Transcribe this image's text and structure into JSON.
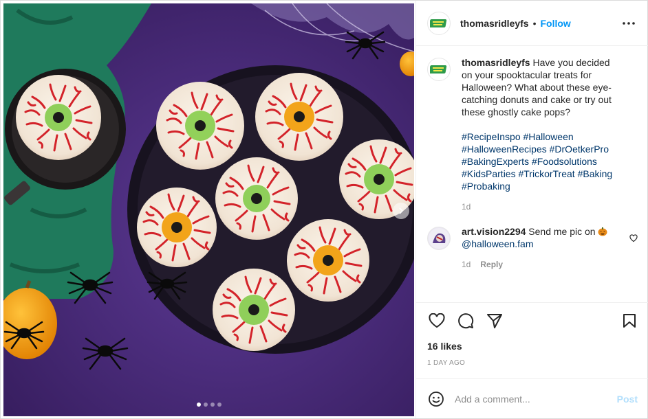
{
  "post": {
    "username": "thomasridleyfs",
    "separator": "•",
    "follow_label": "Follow",
    "more_icon": "more-horizontal-icon",
    "carousel": {
      "total_slides": 4,
      "active_slide": 1
    }
  },
  "caption": {
    "username": "thomasridleyfs",
    "text": "Have you decided on your spooktacular treats for Halloween? What about these eye-catching donuts and cake or try out these ghostly cake pops?",
    "hashtags": "#RecipeInspo #Halloween #HalloweenRecipes #DrOetkerPro #BakingExperts #Foodsolutions #KidsParties #TrickorTreat #Baking #Probaking",
    "age": "1d"
  },
  "comment": {
    "username": "art.vision2294",
    "text": "Send me pic on",
    "mention": "@halloween.fam",
    "age": "1d",
    "reply_label": "Reply"
  },
  "actions": {
    "likes": "16 likes",
    "date": "1 DAY AGO"
  },
  "add_comment": {
    "placeholder": "Add a comment...",
    "post_label": "Post"
  },
  "colors": {
    "follow_blue": "#0095f6",
    "hashtag_blue": "#00376b",
    "post_disabled": "#b2dffc",
    "muted": "#8e8e8e",
    "background_purple": "#4a2a78"
  }
}
